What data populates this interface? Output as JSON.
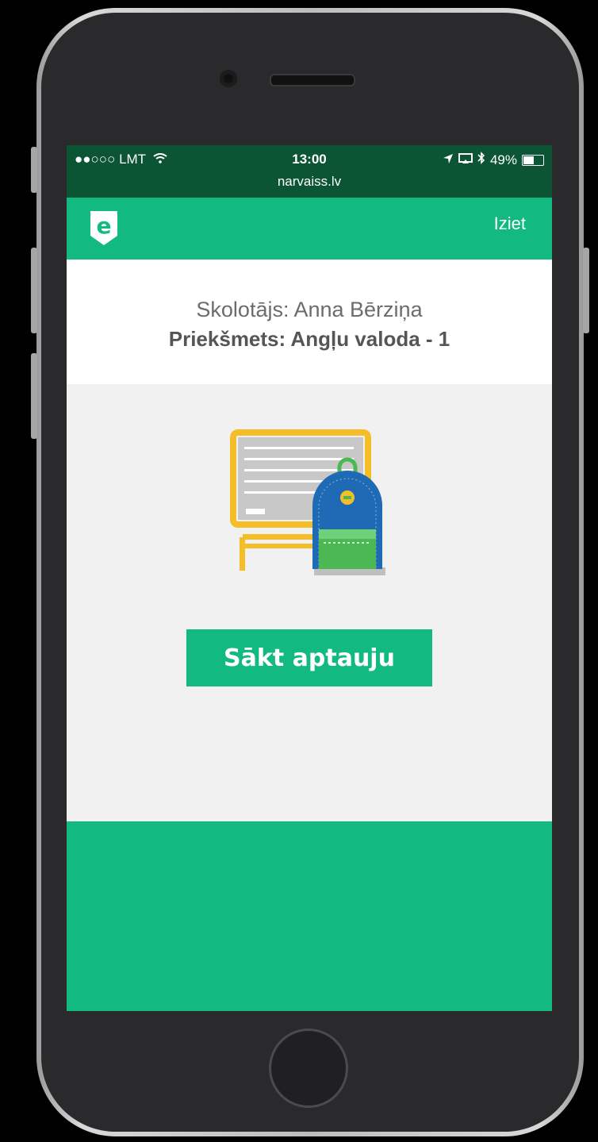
{
  "status_bar": {
    "carrier": "●●○○○ LMT",
    "time": "13:00",
    "battery": "49%",
    "battery_level": 0.49,
    "url": "narvaiss.lv"
  },
  "app_bar": {
    "logo_letter": "e",
    "logout_label": "Iziet"
  },
  "info": {
    "teacher": "Skolotājs: Anna Bērziņa",
    "subject": "Priekšmets: Angļu valoda - 1"
  },
  "main": {
    "start_button_label": "Sākt aptauju"
  },
  "colors": {
    "brand_green": "#12b981",
    "status_bar_green": "#0c5534",
    "board_yellow": "#f5be28",
    "backpack_blue": "#1e6ab4",
    "pocket_green": "#4cb853"
  }
}
